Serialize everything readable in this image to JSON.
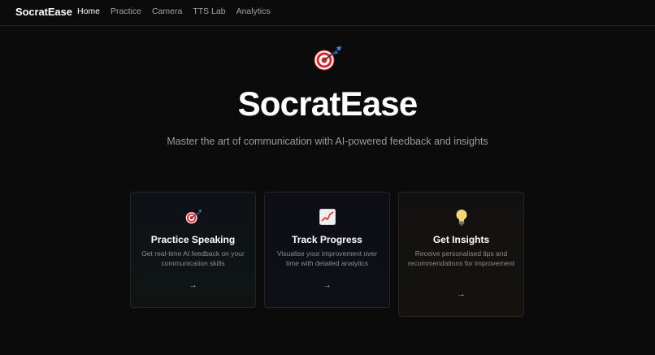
{
  "nav": {
    "brand": "SocratEase",
    "links": [
      {
        "label": "Home",
        "active": true
      },
      {
        "label": "Practice",
        "active": false
      },
      {
        "label": "Camera",
        "active": false
      },
      {
        "label": "TTS Lab",
        "active": false
      },
      {
        "label": "Analytics",
        "active": false
      }
    ]
  },
  "hero": {
    "icon": "dart-target-icon",
    "title": "SocratEase",
    "subtitle": "Master the art of communication with AI-powered feedback and insights"
  },
  "cards": [
    {
      "icon": "dart-target-icon",
      "title": "Practice Speaking",
      "description": "Get real-time AI feedback on your communication skills",
      "arrow": "→"
    },
    {
      "icon": "chart-increasing-icon",
      "title": "Track Progress",
      "description": "Visualise your improvement over time with detailed analytics",
      "arrow": "→"
    },
    {
      "icon": "light-bulb-icon",
      "title": "Get Insights",
      "description": "Receive personalised tips and recommendations for improvement",
      "arrow": "→"
    }
  ],
  "colors": {
    "background": "#0b0b0c",
    "text_primary": "#ffffff",
    "text_muted": "#9b9ba1",
    "dart_red": "#d8262b",
    "chart_line": "#e23a3a"
  }
}
